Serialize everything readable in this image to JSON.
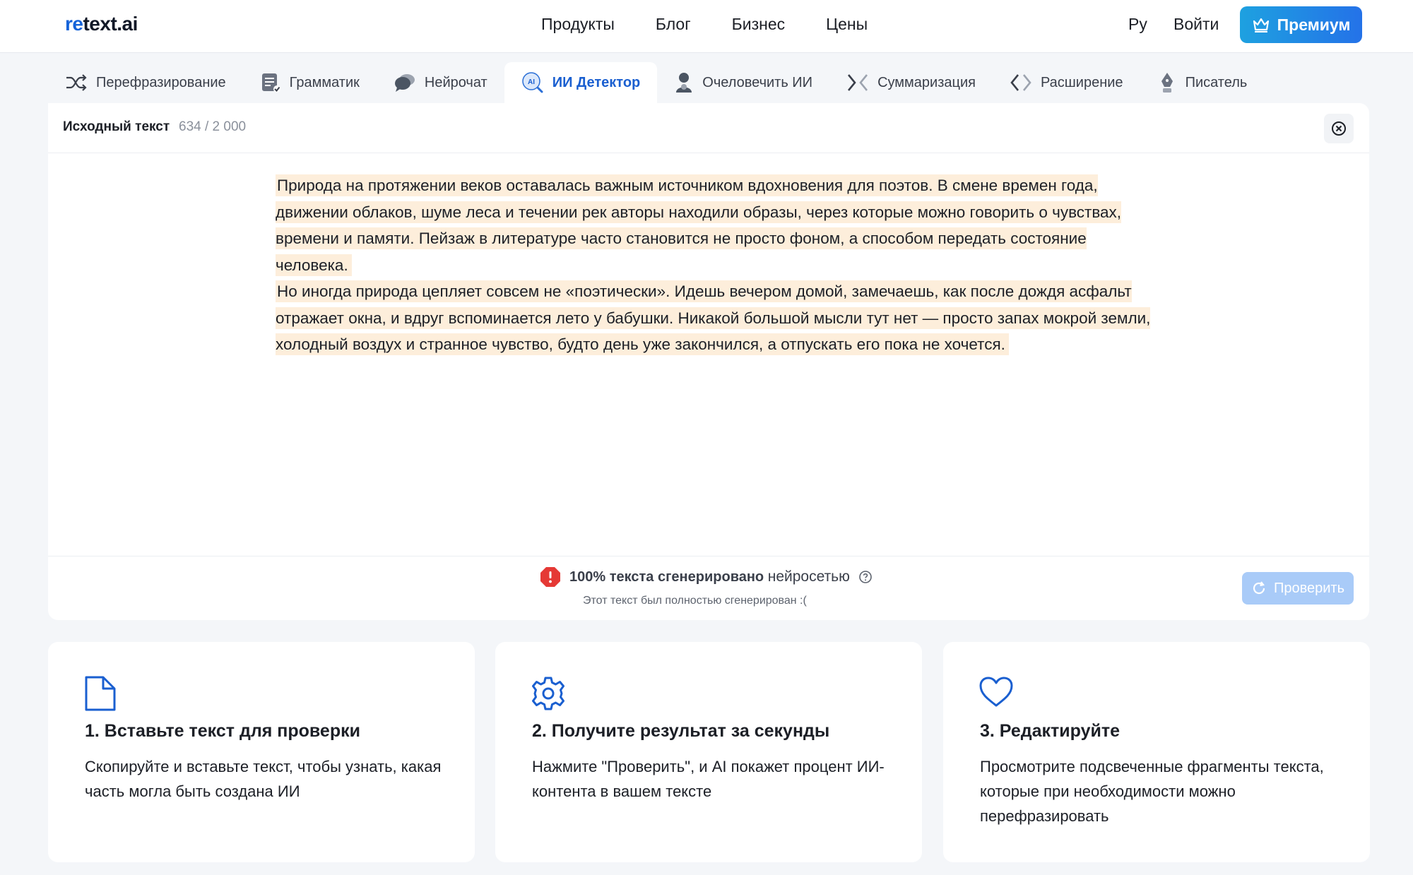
{
  "header": {
    "logo_accent": "re",
    "logo_rest": "text.ai",
    "nav": [
      "Продукты",
      "Блог",
      "Бизнес",
      "Цены"
    ],
    "lang": "Ру",
    "login": "Войти",
    "premium": "Премиум"
  },
  "tabs": [
    {
      "label": "Перефразирование",
      "icon": "shuffle-icon"
    },
    {
      "label": "Грамматик",
      "icon": "grammar-icon"
    },
    {
      "label": "Нейрочат",
      "icon": "chat-icon"
    },
    {
      "label": "ИИ Детектор",
      "icon": "ai-detector-icon",
      "active": true
    },
    {
      "label": "Очеловечить ИИ",
      "icon": "humanize-icon"
    },
    {
      "label": "Суммаризация",
      "icon": "summarize-icon"
    },
    {
      "label": "Расширение",
      "icon": "expand-icon"
    },
    {
      "label": "Писатель",
      "icon": "writer-icon"
    }
  ],
  "editor": {
    "source_label": "Исходный текст",
    "char_count": "634 / 2 000",
    "paragraphs": [
      "Природа на протяжении веков оставалась важным источником вдохновения для поэтов. В смене времен года, движении облаков, шуме леса и течении рек авторы находили образы, через которые можно говорить о чувствах, времени и памяти. Пейзаж в литературе часто становится не просто фоном, а способом передать состояние человека.",
      "Но иногда природа цепляет совсем не «поэтически». Идешь вечером домой, замечаешь, как после дождя асфальт отражает окна, и вдруг вспоминается лето у бабушки. Никакой большой мысли тут нет — просто запах мокрой земли, холодный воздух и странное чувство, будто день уже закончился, а отпускать его пока не хочется."
    ],
    "result_main": "100% текста сгенерировано",
    "result_main_light": "нейросетью",
    "result_sub": "Этот текст был полностью сгенерирован :(",
    "check_button": "Проверить"
  },
  "cards": [
    {
      "icon": "document-icon",
      "title": "1. Вставьте текст для проверки",
      "text": "Скопируйте и вставьте текст, чтобы узнать, какая часть могла быть создана ИИ"
    },
    {
      "icon": "gear-icon",
      "title": "2. Получите результат за секунды",
      "text": "Нажмите \"Проверить\", и AI покажет процент ИИ-контента в вашем тексте"
    },
    {
      "icon": "heart-icon",
      "title": "3. Редактируйте",
      "text": "Просмотрите подсвеченные фрагменты текста, которые при необходимости можно перефразировать"
    }
  ],
  "colors": {
    "accent": "#1a5fd0",
    "highlight": "#fdeedb",
    "warning": "#e53935",
    "premium_from": "#1ea1e0",
    "premium_to": "#2472e8"
  }
}
